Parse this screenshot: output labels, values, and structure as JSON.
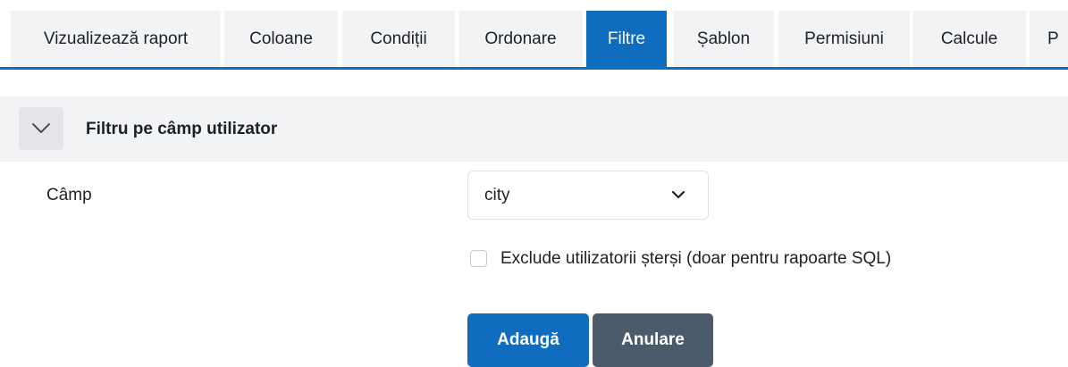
{
  "tabs": [
    {
      "label": "Vizualizează raport",
      "active": false
    },
    {
      "label": "Coloane",
      "active": false
    },
    {
      "label": "Condiții",
      "active": false
    },
    {
      "label": "Ordonare",
      "active": false
    },
    {
      "label": "Filtre",
      "active": true
    },
    {
      "label": "Șablon",
      "active": false
    },
    {
      "label": "Permisiuni",
      "active": false
    },
    {
      "label": "Calcule",
      "active": false
    },
    {
      "label": "P",
      "active": false
    }
  ],
  "section": {
    "title": "Filtru pe câmp utilizator",
    "collapse_icon": "chevron-down-icon"
  },
  "field": {
    "label": "Câmp",
    "selected_value": "city",
    "dropdown_icon": "chevron-down-icon"
  },
  "exclude_deleted": {
    "label": "Exclude utilizatorii șterși (doar pentru rapoarte SQL)",
    "checked": false
  },
  "buttons": {
    "add": "Adaugă",
    "cancel": "Anulare"
  },
  "colors": {
    "accent": "#0f6cbf",
    "secondary": "#4b5b6b",
    "panel": "#f2f3f5"
  }
}
